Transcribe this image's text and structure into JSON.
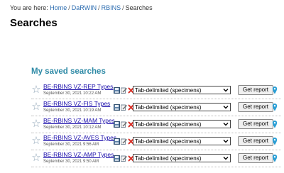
{
  "breadcrumb": {
    "prefix": "You are here:",
    "items": [
      "Home",
      "DaRWIN",
      "RBINS"
    ],
    "current": "Searches"
  },
  "page_title": "Searches",
  "section_title": "My saved searches",
  "saved_searches": [
    {
      "name": "BE-RBINS VZ-REP Types",
      "date": "September 30, 2021 10:22 AM",
      "format": "Tab-delimited (specimens)",
      "button": "Get report"
    },
    {
      "name": "BE-RBINS VZ-FIS Types",
      "date": "September 30, 2021 10:19 AM",
      "format": "Tab-delimited (specimens)",
      "button": "Get report"
    },
    {
      "name": "BE-RBINS VZ-MAM Types",
      "date": "September 30, 2021 10:12 AM",
      "format": "Tab-delimited (specimens)",
      "button": "Get report"
    },
    {
      "name": "BE-RBINS VZ-AVES Types",
      "date": "September 30, 2021 9:56 AM",
      "format": "Tab-delimited (specimens)",
      "button": "Get report"
    },
    {
      "name": "BE-RBINS VZ-AMP Types",
      "date": "September 30, 2021 9:50 AM",
      "format": "Tab-delimited (specimens)",
      "button": "Get report"
    }
  ],
  "colors": {
    "link": "#1a0dab",
    "section_title": "#2e8aa6",
    "delete_icon": "#d9342b",
    "pin_icon": "#2a9fd6"
  },
  "icons": [
    "star-icon",
    "save-icon",
    "edit-icon",
    "delete-icon",
    "map-pin-icon"
  ]
}
